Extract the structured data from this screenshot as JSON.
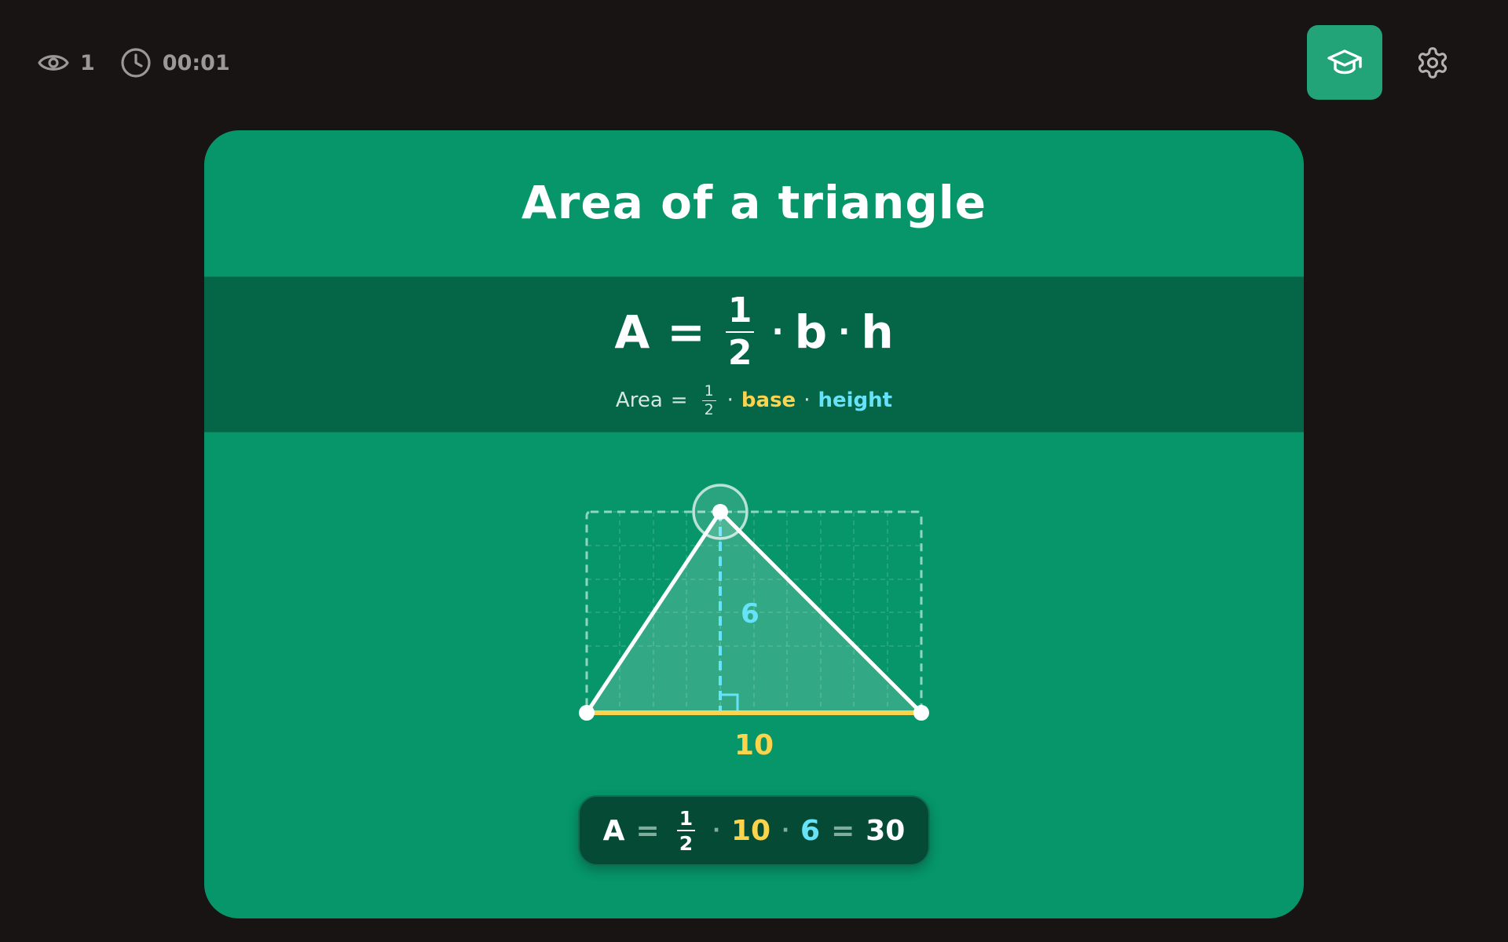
{
  "topbar": {
    "views_count": "1",
    "timer": "00:01"
  },
  "icons": {
    "views": "eye-icon",
    "timer": "clock-icon",
    "learn": "graduation-cap-icon",
    "settings": "gear-icon"
  },
  "card": {
    "title": "Area of a triangle",
    "formula": {
      "lhs": "A",
      "equals": "=",
      "frac_num": "1",
      "frac_den": "2",
      "dot": "·",
      "b": "b",
      "h": "h"
    },
    "formula_words": {
      "area": "Area",
      "equals": "=",
      "frac_num": "1",
      "frac_den": "2",
      "dot": "·",
      "base": "base",
      "height": "height"
    },
    "diagram": {
      "base_value": 10,
      "height_value": 6,
      "base_label": "10",
      "height_label": "6"
    },
    "result": {
      "lhs": "A",
      "equals": "=",
      "frac_num": "1",
      "frac_den": "2",
      "dot": "·",
      "base": "10",
      "height": "6",
      "value": "30"
    }
  },
  "colors": {
    "background": "#181413",
    "card": "#069669",
    "formula_band": "#046647",
    "accent_button": "#22a478",
    "base": "#fcd34d",
    "height": "#67e3f9"
  }
}
